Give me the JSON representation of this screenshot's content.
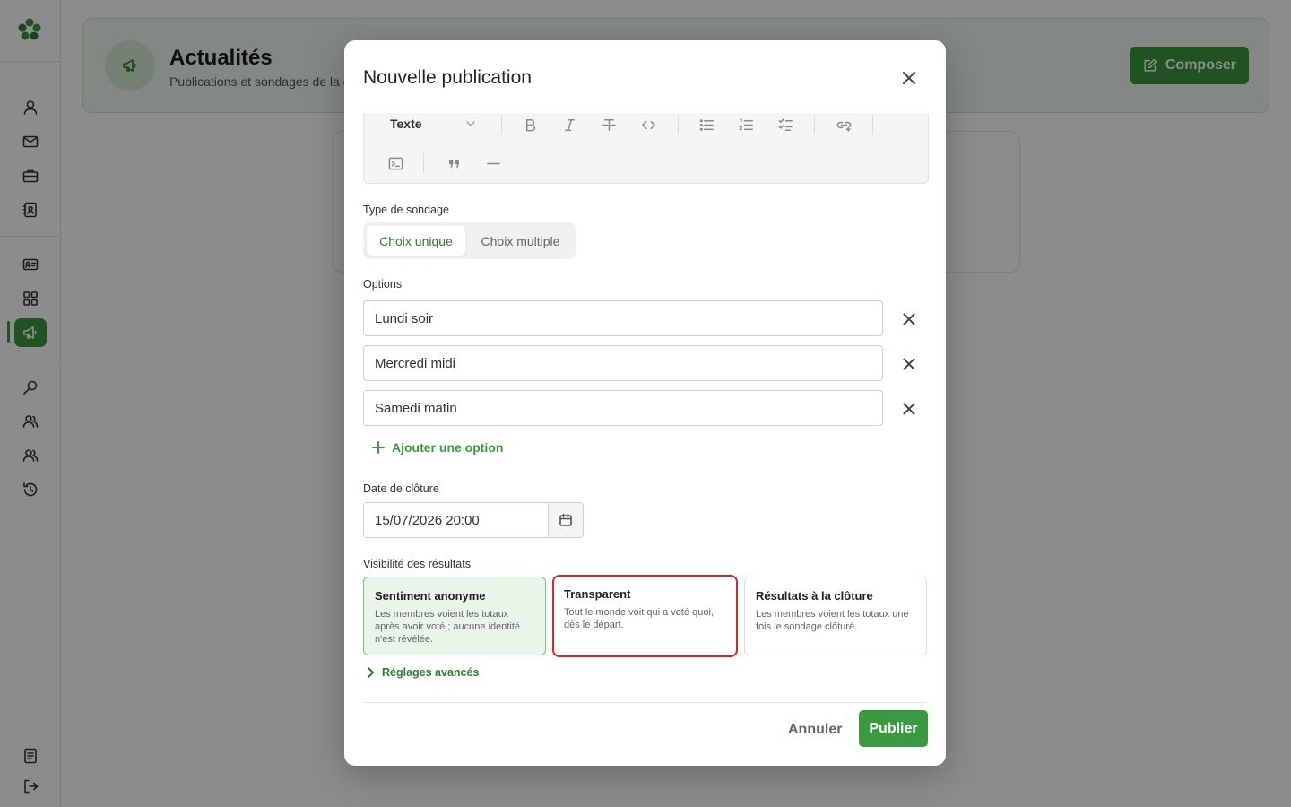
{
  "page": {
    "title": "Actualités",
    "subtitle": "Publications et sondages de la communauté",
    "compose_label": "Composer"
  },
  "modal": {
    "title": "Nouvelle publication",
    "toolbar": {
      "block_type": "Texte"
    },
    "poll_type": {
      "label": "Type de sondage",
      "options": [
        "Choix unique",
        "Choix multiple"
      ],
      "selected": "Choix unique"
    },
    "options": {
      "label": "Options",
      "items": [
        "Lundi soir",
        "Mercredi midi",
        "Samedi matin"
      ],
      "add_label": "Ajouter une option"
    },
    "close_date": {
      "label": "Date de clôture",
      "value": "15/07/2026 20:00"
    },
    "visibility": {
      "label": "Visibilité des résultats",
      "cards": [
        {
          "title": "Sentiment anonyme",
          "desc": "Les membres voient les totaux après avoir voté ; aucune identité n'est révélée."
        },
        {
          "title": "Transparent",
          "desc": "Tout le monde voit qui a voté quoi, dès le départ."
        },
        {
          "title": "Résultats à la clôture",
          "desc": "Les membres voient les totaux une fois le sondage clôturé."
        }
      ]
    },
    "advanced_label": "Réglages avancés",
    "cancel_label": "Annuler",
    "publish_label": "Publier"
  },
  "colors": {
    "accent": "#3a9a3f",
    "highlight": "#d62828"
  }
}
